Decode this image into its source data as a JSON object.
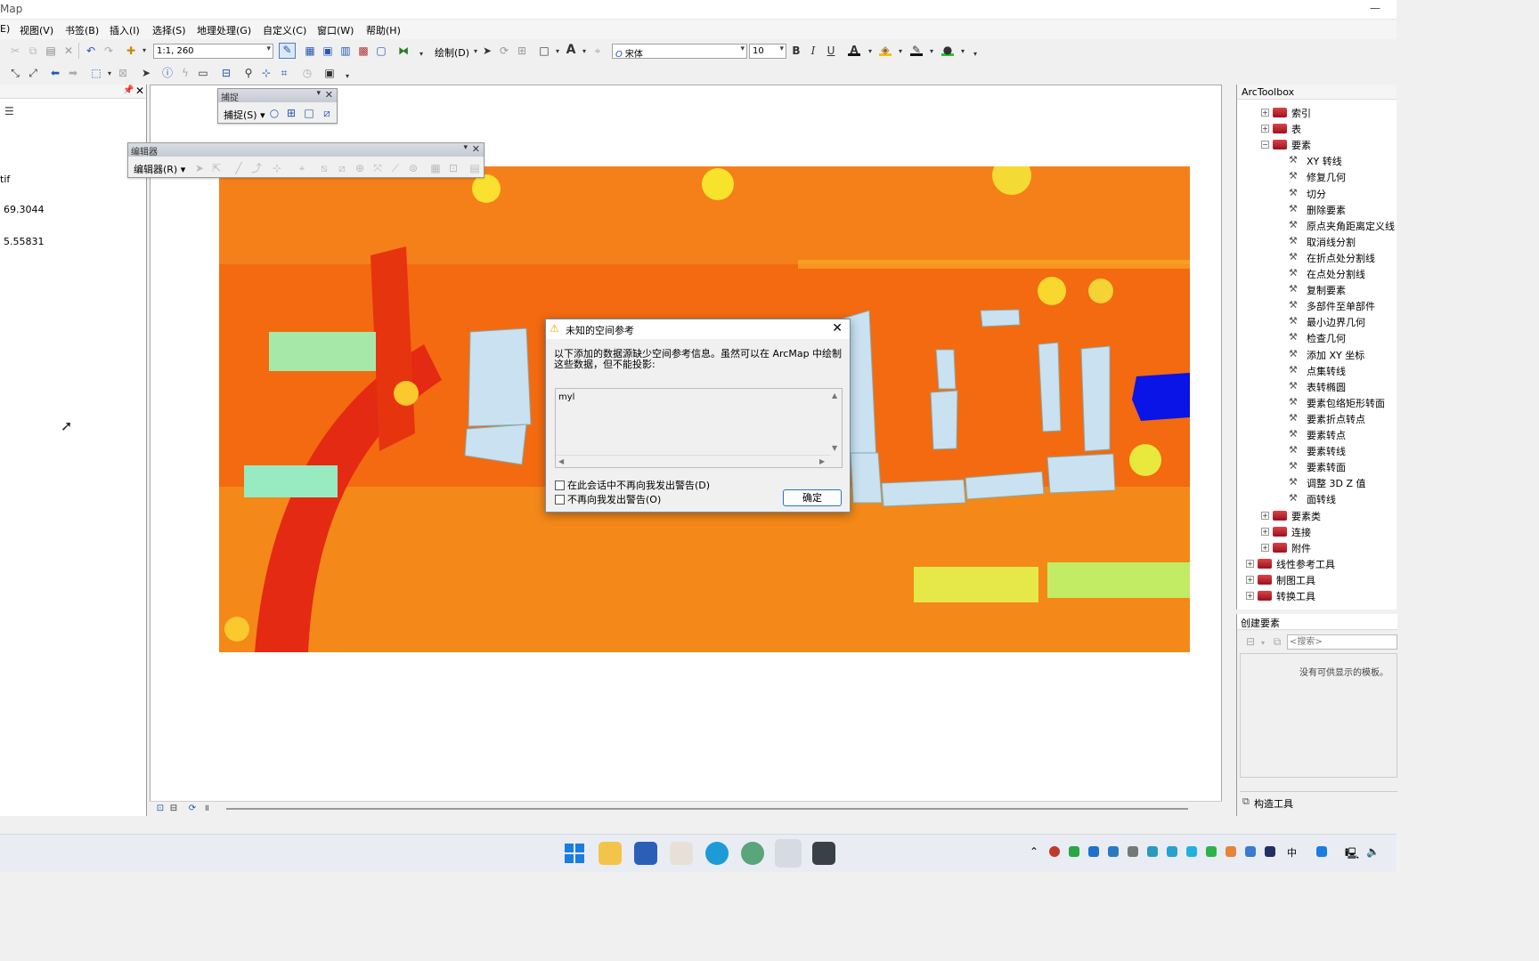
{
  "window": {
    "title": "Map"
  },
  "menu": [
    "E)",
    "视图(V)",
    "书签(B)",
    "插入(I)",
    "选择(S)",
    "地理处理(G)",
    "自定义(C)",
    "窗口(W)",
    "帮助(H)"
  ],
  "toolbar": {
    "scale": "1:1, 260",
    "draw_label": "绘制(D)",
    "font_name": "宋体",
    "font_size": "10",
    "bold": "B",
    "italic": "I",
    "underline": "U"
  },
  "toc": {
    "item_suffix": "tif",
    "value_high": "69.3044",
    "value_low": "5.55831"
  },
  "snapping_toolbar": {
    "title": "捕捉",
    "menu_label": "捕捉(S)"
  },
  "editor_toolbar": {
    "title": "编辑器",
    "menu_label": "编辑器(R)"
  },
  "dialog": {
    "title": "未知的空间参考",
    "message": "以下添加的数据源缺少空间参考信息。虽然可以在 ArcMap 中绘制这些数据，但不能投影:",
    "items": [
      "myl"
    ],
    "checkbox_session": "在此会话中不再向我发出警告(D)",
    "checkbox_never": "不再向我发出警告(O)",
    "ok_label": "确定"
  },
  "arctoolbox": {
    "title": "ArcToolbox",
    "nodes": [
      {
        "label": "索引",
        "level": 1,
        "kind": "toolbox",
        "expanded": false
      },
      {
        "label": "表",
        "level": 1,
        "kind": "toolbox",
        "expanded": false
      },
      {
        "label": "要素",
        "level": 1,
        "kind": "toolbox",
        "expanded": true
      },
      {
        "label": "XY 转线",
        "level": 2,
        "kind": "tool"
      },
      {
        "label": "修复几何",
        "level": 2,
        "kind": "tool"
      },
      {
        "label": "切分",
        "level": 2,
        "kind": "tool"
      },
      {
        "label": "删除要素",
        "level": 2,
        "kind": "tool"
      },
      {
        "label": "原点夹角距离定义线",
        "level": 2,
        "kind": "tool"
      },
      {
        "label": "取消线分割",
        "level": 2,
        "kind": "tool"
      },
      {
        "label": "在折点处分割线",
        "level": 2,
        "kind": "tool"
      },
      {
        "label": "在点处分割线",
        "level": 2,
        "kind": "tool"
      },
      {
        "label": "复制要素",
        "level": 2,
        "kind": "tool"
      },
      {
        "label": "多部件至单部件",
        "level": 2,
        "kind": "tool"
      },
      {
        "label": "最小边界几何",
        "level": 2,
        "kind": "tool"
      },
      {
        "label": "检查几何",
        "level": 2,
        "kind": "tool"
      },
      {
        "label": "添加 XY 坐标",
        "level": 2,
        "kind": "tool"
      },
      {
        "label": "点集转线",
        "level": 2,
        "kind": "tool"
      },
      {
        "label": "表转椭圆",
        "level": 2,
        "kind": "tool"
      },
      {
        "label": "要素包络矩形转面",
        "level": 2,
        "kind": "tool"
      },
      {
        "label": "要素折点转点",
        "level": 2,
        "kind": "tool"
      },
      {
        "label": "要素转点",
        "level": 2,
        "kind": "tool"
      },
      {
        "label": "要素转线",
        "level": 2,
        "kind": "tool"
      },
      {
        "label": "要素转面",
        "level": 2,
        "kind": "tool"
      },
      {
        "label": "调整 3D Z 值",
        "level": 2,
        "kind": "tool"
      },
      {
        "label": "面转线",
        "level": 2,
        "kind": "tool"
      },
      {
        "label": "要素类",
        "level": 1,
        "kind": "toolbox",
        "expanded": false
      },
      {
        "label": "连接",
        "level": 1,
        "kind": "toolbox",
        "expanded": false
      },
      {
        "label": "附件",
        "level": 1,
        "kind": "toolbox",
        "expanded": false
      },
      {
        "label": "线性参考工具",
        "level": 0,
        "kind": "toolbox",
        "expanded": false
      },
      {
        "label": "制图工具",
        "level": 0,
        "kind": "toolbox",
        "expanded": false
      },
      {
        "label": "转换工具",
        "level": 0,
        "kind": "toolbox",
        "expanded": false
      }
    ]
  },
  "create_features": {
    "title": "创建要素",
    "search_placeholder": "<搜索>",
    "empty_message": "没有可供显示的模板。",
    "construct_tools": "构造工具"
  },
  "colors": {
    "accent": "#2573d0",
    "raster_base": "#f36a10",
    "building": "#c9e1f0",
    "selected_polygon": "#0a14e6"
  }
}
